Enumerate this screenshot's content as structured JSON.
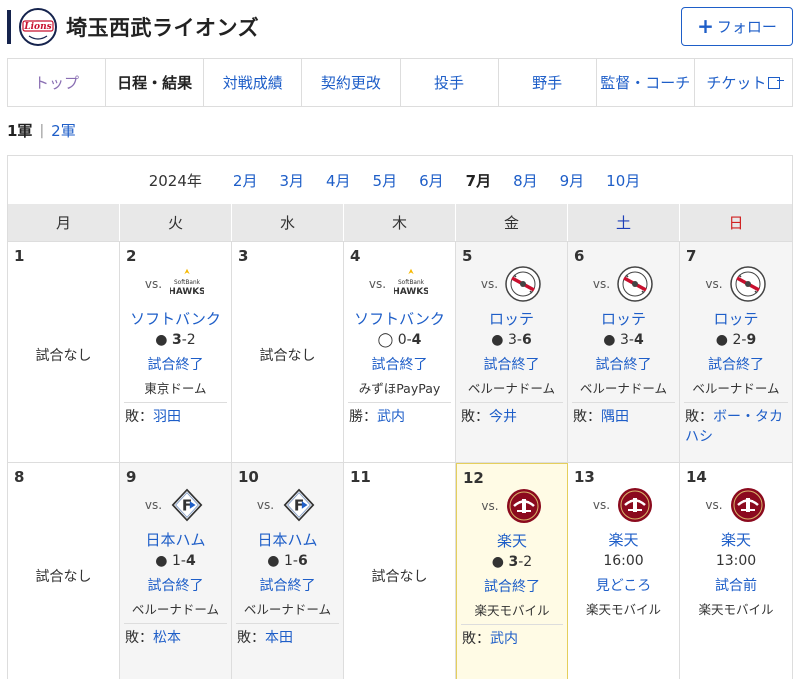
{
  "header": {
    "team_name": "埼玉西武ライオンズ",
    "follow_label": "フォロー"
  },
  "tabs": [
    "トップ",
    "日程・結果",
    "対戦成績",
    "契約更改",
    "投手",
    "野手",
    "監督・コーチ",
    "チケット"
  ],
  "squad": {
    "current": "1軍",
    "separator": "|",
    "other": "2軍"
  },
  "months": {
    "year": "2024年",
    "items": [
      "2月",
      "3月",
      "4月",
      "5月",
      "6月",
      "7月",
      "8月",
      "9月",
      "10月"
    ],
    "active": "7月"
  },
  "weekdays": [
    "月",
    "火",
    "水",
    "木",
    "金",
    "土",
    "日"
  ],
  "colors": {
    "link": "#1e5ec8",
    "saturday": "#1e3fb8",
    "sunday": "#d02020",
    "home_bg": "#f5f5f5",
    "today_bg": "#fffbe5",
    "navy": "#15234d"
  },
  "icons": {
    "follow": "plus-icon",
    "ticket": "external-link-icon",
    "game_won": "white-circle-icon",
    "game_lost": "black-circle-icon"
  },
  "weeks": [
    [
      {
        "day": "1",
        "no_game": "試合なし"
      },
      {
        "day": "2",
        "vs": "vs.",
        "opponent": "ソフトバンク",
        "logo": "hawks",
        "result_mark": "●",
        "score_left": "3",
        "score_right": "2",
        "bold": "left",
        "status": "試合終了",
        "venue": "東京ドーム",
        "pitcher_label": "敗：",
        "pitcher": "羽田",
        "home": false
      },
      {
        "day": "3",
        "no_game": "試合なし"
      },
      {
        "day": "4",
        "vs": "vs.",
        "opponent": "ソフトバンク",
        "logo": "hawks",
        "result_mark": "◯",
        "score_left": "0",
        "score_right": "4",
        "bold": "right",
        "status": "試合終了",
        "venue": "みずほPayPay",
        "pitcher_label": "勝：",
        "pitcher": "武内",
        "home": false
      },
      {
        "day": "5",
        "vs": "vs.",
        "opponent": "ロッテ",
        "logo": "marines",
        "result_mark": "●",
        "score_left": "3",
        "score_right": "6",
        "bold": "right",
        "status": "試合終了",
        "venue": "ベルーナドーム",
        "pitcher_label": "敗：",
        "pitcher": "今井",
        "home": true
      },
      {
        "day": "6",
        "vs": "vs.",
        "opponent": "ロッテ",
        "logo": "marines",
        "result_mark": "●",
        "score_left": "3",
        "score_right": "4",
        "bold": "right",
        "status": "試合終了",
        "venue": "ベルーナドーム",
        "pitcher_label": "敗：",
        "pitcher": "隅田",
        "home": true
      },
      {
        "day": "7",
        "vs": "vs.",
        "opponent": "ロッテ",
        "logo": "marines",
        "result_mark": "●",
        "score_left": "2",
        "score_right": "9",
        "bold": "right",
        "status": "試合終了",
        "venue": "ベルーナドーム",
        "pitcher_label": "敗：",
        "pitcher": "ボー・タカハシ",
        "home": true
      }
    ],
    [
      {
        "day": "8",
        "no_game": "試合なし"
      },
      {
        "day": "9",
        "vs": "vs.",
        "opponent": "日本ハム",
        "logo": "fighters",
        "result_mark": "●",
        "score_left": "1",
        "score_right": "4",
        "bold": "right",
        "status": "試合終了",
        "venue": "ベルーナドーム",
        "pitcher_label": "敗：",
        "pitcher": "松本",
        "home": true
      },
      {
        "day": "10",
        "vs": "vs.",
        "opponent": "日本ハム",
        "logo": "fighters",
        "result_mark": "●",
        "score_left": "1",
        "score_right": "6",
        "bold": "right",
        "status": "試合終了",
        "venue": "ベルーナドーム",
        "pitcher_label": "敗：",
        "pitcher": "本田",
        "home": true
      },
      {
        "day": "11",
        "no_game": "試合なし"
      },
      {
        "day": "12",
        "vs": "vs.",
        "opponent": "楽天",
        "logo": "eagles",
        "result_mark": "●",
        "score_left": "3",
        "score_right": "2",
        "bold": "left",
        "status": "試合終了",
        "venue": "楽天モバイル",
        "pitcher_label": "敗：",
        "pitcher": "武内",
        "home": false,
        "today": true
      },
      {
        "day": "13",
        "vs": "vs.",
        "opponent": "楽天",
        "logo": "eagles",
        "time": "16:00",
        "status": "見どころ",
        "venue": "楽天モバイル",
        "home": false
      },
      {
        "day": "14",
        "vs": "vs.",
        "opponent": "楽天",
        "logo": "eagles",
        "time": "13:00",
        "status": "試合前",
        "venue": "楽天モバイル",
        "home": false
      }
    ]
  ]
}
